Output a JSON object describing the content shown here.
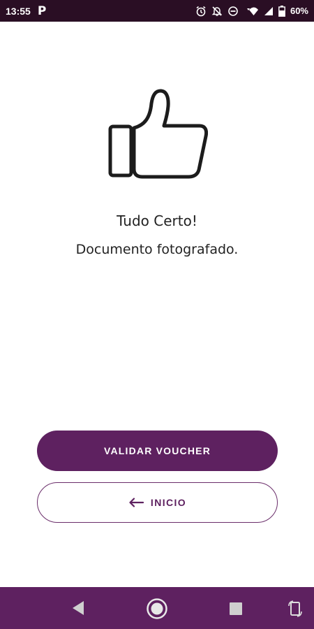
{
  "status_bar": {
    "time": "13:55",
    "app_icon_letter": "P",
    "battery_percent": "60%",
    "icons": [
      "alarm-icon",
      "notifications-off-icon",
      "do-not-disturb-icon",
      "wifi-icon",
      "signal-icon",
      "battery-icon"
    ]
  },
  "main": {
    "illustration": "thumbs-up-icon",
    "title": "Tudo Certo!",
    "subtitle": "Documento fotografado."
  },
  "actions": {
    "validate_label": "VALIDAR VOUCHER",
    "home_label": "INICIO"
  },
  "nav_bar": {
    "buttons": [
      "back-icon",
      "home-icon",
      "recents-icon",
      "rotate-icon"
    ]
  },
  "colors": {
    "brand": "#5e2160",
    "status_bar": "#2a0e24",
    "text": "#222222",
    "background": "#ffffff"
  }
}
